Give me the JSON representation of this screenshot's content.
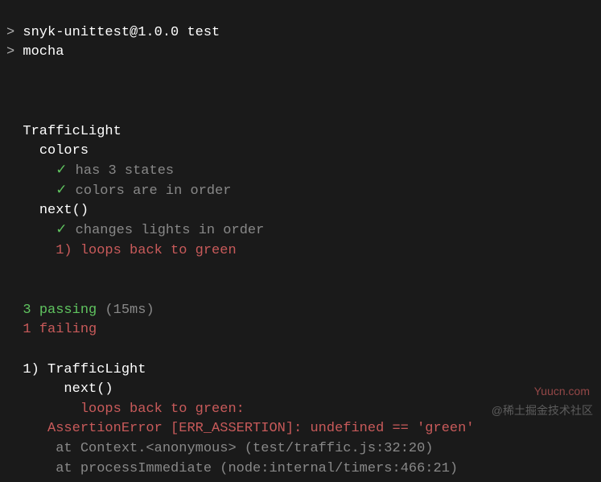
{
  "command": {
    "prompt": ">",
    "line1": "snyk-unittest@1.0.0 test",
    "line2": "mocha"
  },
  "suite": {
    "name": "TrafficLight",
    "groups": [
      {
        "name": "colors",
        "tests": [
          {
            "status": "pass",
            "mark": "✓",
            "label": "has 3 states"
          },
          {
            "status": "pass",
            "mark": "✓",
            "label": "colors are in order"
          }
        ]
      },
      {
        "name": "next()",
        "tests": [
          {
            "status": "pass",
            "mark": "✓",
            "label": "changes lights in order"
          },
          {
            "status": "fail",
            "mark": "1)",
            "label": "loops back to green"
          }
        ]
      }
    ]
  },
  "summary": {
    "passing_count": "3",
    "passing_word": "passing",
    "timing": "(15ms)",
    "failing_count": "1",
    "failing_word": "failing"
  },
  "failure": {
    "index": "1)",
    "suite": "TrafficLight",
    "group": "next()",
    "test": "loops back to green:",
    "error": "AssertionError [ERR_ASSERTION]: undefined == 'green'",
    "stack": [
      "at Context.<anonymous> (test/traffic.js:32:20)",
      "at processImmediate (node:internal/timers:466:21)"
    ]
  },
  "watermarks": {
    "w1": "Yuucn.com",
    "w2": "@稀土掘金技术社区"
  }
}
